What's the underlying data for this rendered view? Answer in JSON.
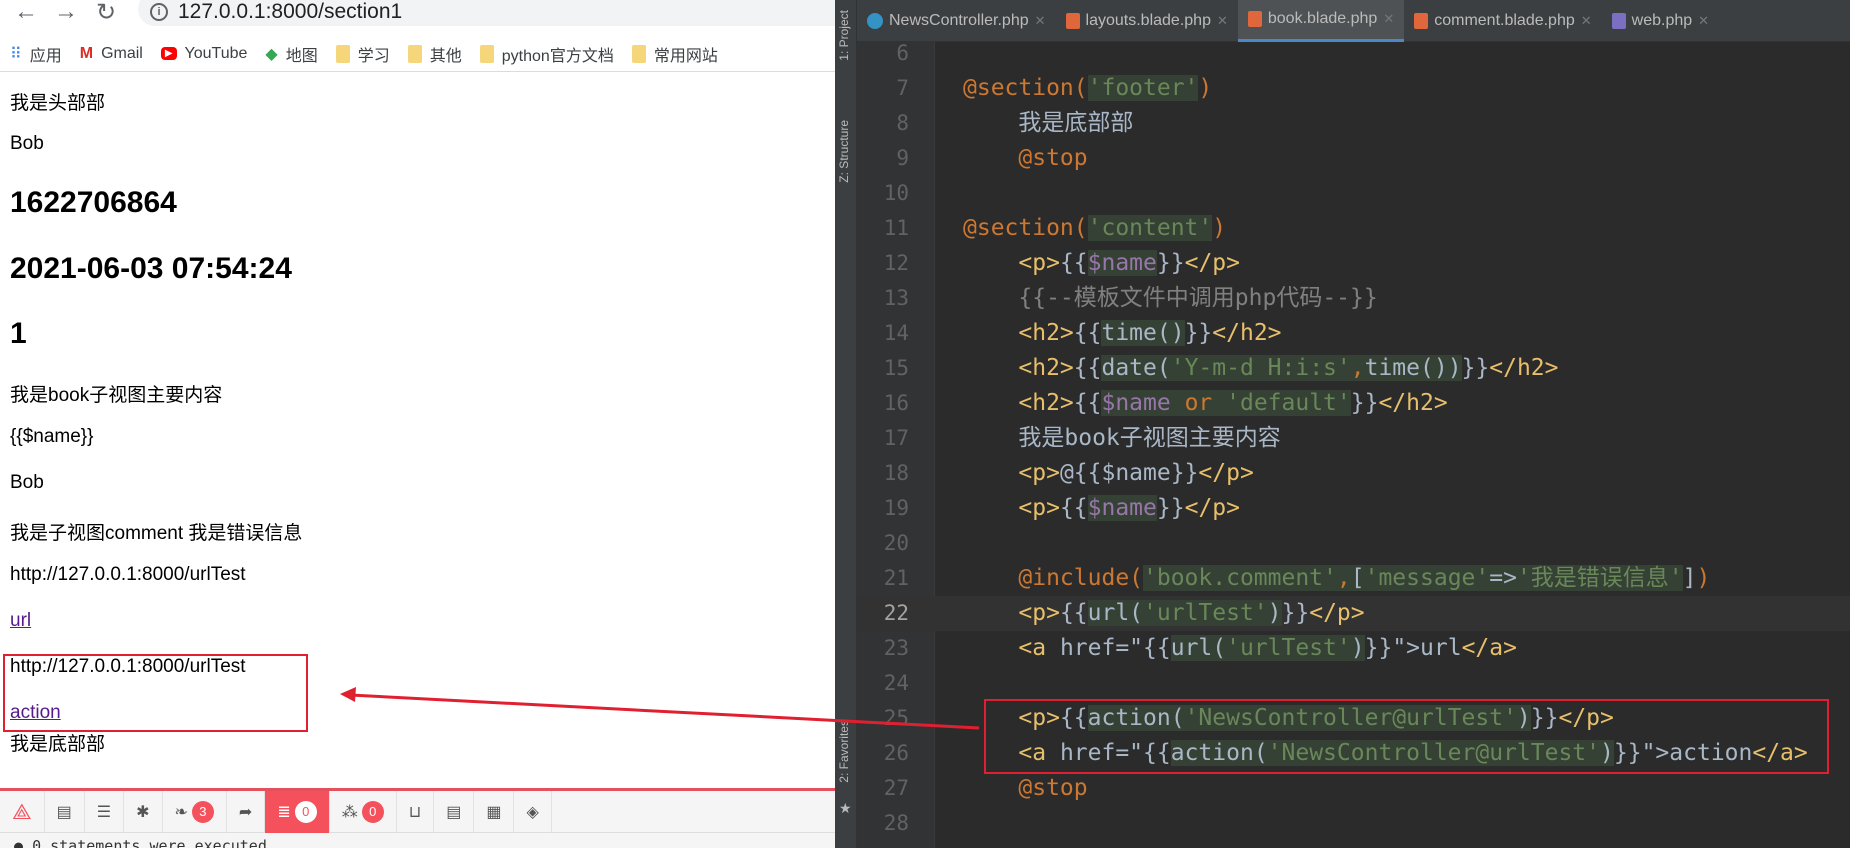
{
  "browser": {
    "nav": {
      "back": "←",
      "forward": "→",
      "reload": "↻"
    },
    "address": "127.0.0.1:8000/section1",
    "bookmarks": [
      {
        "label": "应用",
        "icon": "apps-grid-icon"
      },
      {
        "label": "Gmail",
        "icon": "gmail-icon"
      },
      {
        "label": "YouTube",
        "icon": "youtube-icon"
      },
      {
        "label": "地图",
        "icon": "maps-icon"
      },
      {
        "label": "学习",
        "icon": "folder-icon"
      },
      {
        "label": "其他",
        "icon": "folder-icon"
      },
      {
        "label": "python官方文档",
        "icon": "folder-icon"
      },
      {
        "label": "常用网站",
        "icon": "folder-icon"
      }
    ],
    "page": {
      "header": "我是头部部",
      "name1": "Bob",
      "timestamp": "1622706864",
      "datetime": "2021-06-03 07:54:24",
      "name_or_default": "1",
      "main_text": "我是book子视图主要内容",
      "escaped": "{{$name}}",
      "name2": "Bob",
      "comment": "我是子视图comment 我是错误信息",
      "url_text": "http://127.0.0.1:8000/urlTest",
      "url_link": "url",
      "action_text": "http://127.0.0.1:8000/urlTest",
      "action_link": "action",
      "footer": "我是底部部"
    },
    "debugbar": {
      "badges": {
        "views": "3",
        "queries": "0",
        "models": "0"
      },
      "status": "0 statements were executed",
      "accent": "#f4515d"
    }
  },
  "ide": {
    "toolstrip": {
      "project": "1: Project",
      "structure": "Z: Structure",
      "favorites": "2: Favorites"
    },
    "tabs": [
      {
        "label": "NewsController.php",
        "icon": "c"
      },
      {
        "label": "layouts.blade.php",
        "icon": "blade"
      },
      {
        "label": "book.blade.php",
        "icon": "blade",
        "active": true
      },
      {
        "label": "comment.blade.php",
        "icon": "blade"
      },
      {
        "label": "web.php",
        "icon": "php"
      }
    ],
    "current_line": 22,
    "lines": [
      {
        "n": "6",
        "tokens": []
      },
      {
        "n": "7",
        "tokens": [
          [
            "@section(",
            "dir"
          ],
          [
            "'footer'",
            "str",
            1
          ],
          [
            ")",
            "dir"
          ]
        ]
      },
      {
        "n": "8",
        "tokens": [
          [
            "    ",
            "text"
          ],
          [
            "我是底部部",
            "text"
          ]
        ]
      },
      {
        "n": "9",
        "tokens": [
          [
            "    ",
            "text"
          ],
          [
            "@stop",
            "dir"
          ]
        ]
      },
      {
        "n": "10",
        "tokens": []
      },
      {
        "n": "11",
        "tokens": [
          [
            "@section(",
            "dir"
          ],
          [
            "'content'",
            "str",
            1
          ],
          [
            ")",
            "dir"
          ]
        ]
      },
      {
        "n": "12",
        "tokens": [
          [
            "    ",
            "text"
          ],
          [
            "<p>",
            "tag"
          ],
          [
            "{{",
            "brace"
          ],
          [
            "$name",
            "var",
            1
          ],
          [
            "}}",
            "brace"
          ],
          [
            "</p>",
            "tag"
          ]
        ]
      },
      {
        "n": "13",
        "tokens": [
          [
            "    ",
            "text"
          ],
          [
            "{{--模板文件中调用php代码--}}",
            "cmt"
          ]
        ]
      },
      {
        "n": "14",
        "tokens": [
          [
            "    ",
            "text"
          ],
          [
            "<h2>",
            "tag"
          ],
          [
            "{{",
            "brace"
          ],
          [
            "time()",
            "text",
            1
          ],
          [
            "}}",
            "brace"
          ],
          [
            "</h2>",
            "tag"
          ]
        ]
      },
      {
        "n": "15",
        "tokens": [
          [
            "    ",
            "text"
          ],
          [
            "<h2>",
            "tag"
          ],
          [
            "{{",
            "brace"
          ],
          [
            "date(",
            "text",
            1
          ],
          [
            "'Y-m-d H:i:s'",
            "str",
            1
          ],
          [
            ",",
            "dir",
            1
          ],
          [
            "time())",
            "text",
            1
          ],
          [
            "}}",
            "brace"
          ],
          [
            "</h2>",
            "tag"
          ]
        ]
      },
      {
        "n": "16",
        "tokens": [
          [
            "    ",
            "text"
          ],
          [
            "<h2>",
            "tag"
          ],
          [
            "{{",
            "brace"
          ],
          [
            "$name",
            "var",
            1
          ],
          [
            " or ",
            "kw",
            1
          ],
          [
            "'default'",
            "str",
            1
          ],
          [
            "}}",
            "brace"
          ],
          [
            "</h2>",
            "tag"
          ]
        ]
      },
      {
        "n": "17",
        "tokens": [
          [
            "    ",
            "text"
          ],
          [
            "我是book子视图主要内容",
            "text"
          ]
        ]
      },
      {
        "n": "18",
        "tokens": [
          [
            "    ",
            "text"
          ],
          [
            "<p>",
            "tag"
          ],
          [
            "@{{$name}}",
            "text"
          ],
          [
            "</p>",
            "tag"
          ]
        ]
      },
      {
        "n": "19",
        "tokens": [
          [
            "    ",
            "text"
          ],
          [
            "<p>",
            "tag"
          ],
          [
            "{{",
            "brace"
          ],
          [
            "$name",
            "var",
            1
          ],
          [
            "}}",
            "brace"
          ],
          [
            "</p>",
            "tag"
          ]
        ]
      },
      {
        "n": "20",
        "tokens": []
      },
      {
        "n": "21",
        "tokens": [
          [
            "    ",
            "text"
          ],
          [
            "@include(",
            "dir"
          ],
          [
            "'book.comment'",
            "str",
            1
          ],
          [
            ",",
            "dir",
            1
          ],
          [
            "[",
            "text",
            1
          ],
          [
            "'message'",
            "str",
            1
          ],
          [
            "=>",
            "text",
            1
          ],
          [
            "'我是错误信息'",
            "str",
            1
          ],
          [
            "]",
            "text"
          ],
          [
            ")",
            "dir"
          ]
        ]
      },
      {
        "n": "22",
        "tokens": [
          [
            "    ",
            "text"
          ],
          [
            "<p>",
            "tag"
          ],
          [
            "{{",
            "brace"
          ],
          [
            "url(",
            "text",
            1
          ],
          [
            "'urlTest'",
            "str",
            1
          ],
          [
            ")",
            "text",
            1
          ],
          [
            "}}",
            "brace"
          ],
          [
            "</p>",
            "tag"
          ]
        ]
      },
      {
        "n": "23",
        "tokens": [
          [
            "    ",
            "text"
          ],
          [
            "<a ",
            "tag"
          ],
          [
            "href=\"",
            "text"
          ],
          [
            "{{",
            "brace"
          ],
          [
            "url(",
            "text",
            1
          ],
          [
            "'urlTest'",
            "str",
            1
          ],
          [
            ")",
            "text",
            1
          ],
          [
            "}}",
            "brace"
          ],
          [
            "\">url",
            "text"
          ],
          [
            "</a>",
            "tag"
          ]
        ]
      },
      {
        "n": "24",
        "tokens": []
      },
      {
        "n": "25",
        "tokens": [
          [
            "    ",
            "text"
          ],
          [
            "<p>",
            "tag"
          ],
          [
            "{{",
            "brace"
          ],
          [
            "action(",
            "text",
            1
          ],
          [
            "'NewsController@urlTest'",
            "str",
            1
          ],
          [
            ")",
            "text",
            1
          ],
          [
            "}}",
            "brace"
          ],
          [
            "</p>",
            "tag"
          ]
        ]
      },
      {
        "n": "26",
        "tokens": [
          [
            "    ",
            "text"
          ],
          [
            "<a ",
            "tag"
          ],
          [
            "href=\"",
            "text"
          ],
          [
            "{{",
            "brace"
          ],
          [
            "action(",
            "text",
            1
          ],
          [
            "'NewsController@urlTest'",
            "str",
            1
          ],
          [
            ")",
            "text",
            1
          ],
          [
            "}}",
            "brace"
          ],
          [
            "\">action",
            "text"
          ],
          [
            "</a>",
            "tag"
          ]
        ]
      },
      {
        "n": "27",
        "tokens": [
          [
            "    ",
            "text"
          ],
          [
            "@stop",
            "dir"
          ]
        ]
      },
      {
        "n": "28",
        "tokens": []
      }
    ]
  },
  "annotation_color": "#e02030"
}
